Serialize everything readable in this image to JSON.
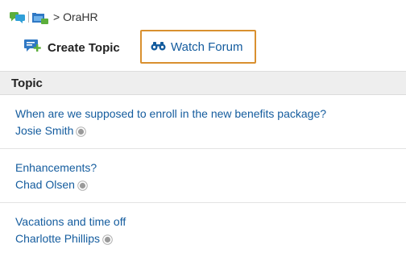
{
  "breadcrumb": {
    "icons": [
      "chat-forum-icon",
      "folder-icon"
    ],
    "separator": ">",
    "current": "OraHR"
  },
  "toolbar": {
    "create_topic": {
      "label": "Create Topic",
      "icon": "create-topic-icon"
    },
    "watch_forum": {
      "label": "Watch Forum",
      "icon": "binoculars-icon"
    }
  },
  "table": {
    "header": "Topic",
    "rows": [
      {
        "title": "When are we supposed to enroll in the new benefits package?",
        "author": "Josie Smith"
      },
      {
        "title": "Enhancements?",
        "author": "Chad Olsen"
      },
      {
        "title": "Vacations and time off",
        "author": "Charlotte Phillips"
      }
    ]
  },
  "colors": {
    "link": "#145c9e",
    "focus_border": "#d9902f",
    "header_bg": "#eeeeee",
    "icon_green": "#5cae3c",
    "icon_blue": "#2f78c4"
  }
}
